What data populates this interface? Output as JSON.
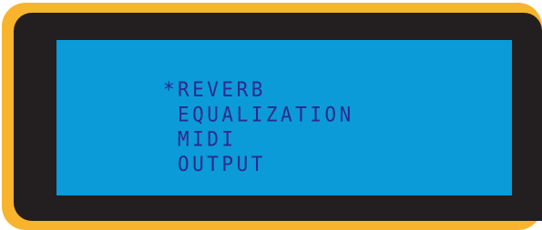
{
  "device": {
    "frame_color": "#f9b42d",
    "bezel_color": "#231f20",
    "screen_color": "#0b9bd8",
    "text_color": "#2b2a8c"
  },
  "menu": {
    "cursor_symbol": "*",
    "selected_index": 0,
    "items": [
      {
        "label": "REVERB",
        "cursor": "*"
      },
      {
        "label": "EQUALIZATION",
        "cursor": ""
      },
      {
        "label": "MIDI",
        "cursor": ""
      },
      {
        "label": "OUTPUT",
        "cursor": ""
      }
    ]
  }
}
